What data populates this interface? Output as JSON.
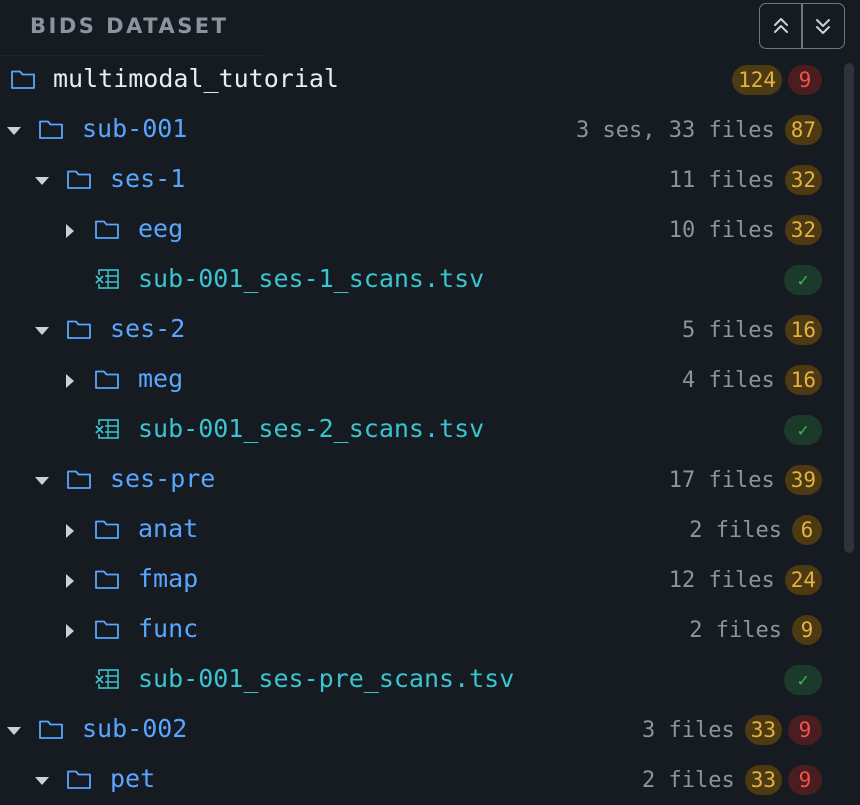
{
  "header": {
    "title": "BIDS DATASET"
  },
  "toolbar": {
    "collapse_icon": "collapse-all-icon",
    "expand_icon": "expand-all-icon"
  },
  "colors": {
    "folder": "#58a6ff",
    "file": "#39c5cf",
    "warning": "#e3b341",
    "error": "#f85149",
    "ok": "#3fb950"
  },
  "tree": {
    "rows": [
      {
        "label": "multimodal_tutorial",
        "meta": "",
        "warnings": "124",
        "errors": "9"
      },
      {
        "label": "sub-001",
        "meta": "3 ses, 33 files",
        "warnings": "87"
      },
      {
        "label": "ses-1",
        "meta": "11 files",
        "warnings": "32"
      },
      {
        "label": "eeg",
        "meta": "10 files",
        "warnings": "32"
      },
      {
        "label": "sub-001_ses-1_scans.tsv",
        "status": "✓"
      },
      {
        "label": "ses-2",
        "meta": "5 files",
        "warnings": "16"
      },
      {
        "label": "meg",
        "meta": "4 files",
        "warnings": "16"
      },
      {
        "label": "sub-001_ses-2_scans.tsv",
        "status": "✓"
      },
      {
        "label": "ses-pre",
        "meta": "17 files",
        "warnings": "39"
      },
      {
        "label": "anat",
        "meta": "2 files",
        "warnings": "6"
      },
      {
        "label": "fmap",
        "meta": "12 files",
        "warnings": "24"
      },
      {
        "label": "func",
        "meta": "2 files",
        "warnings": "9"
      },
      {
        "label": "sub-001_ses-pre_scans.tsv",
        "status": "✓"
      },
      {
        "label": "sub-002",
        "meta": "3 files",
        "warnings": "33",
        "errors": "9"
      },
      {
        "label": "pet",
        "meta": "2 files",
        "warnings": "33",
        "errors": "9"
      }
    ]
  }
}
